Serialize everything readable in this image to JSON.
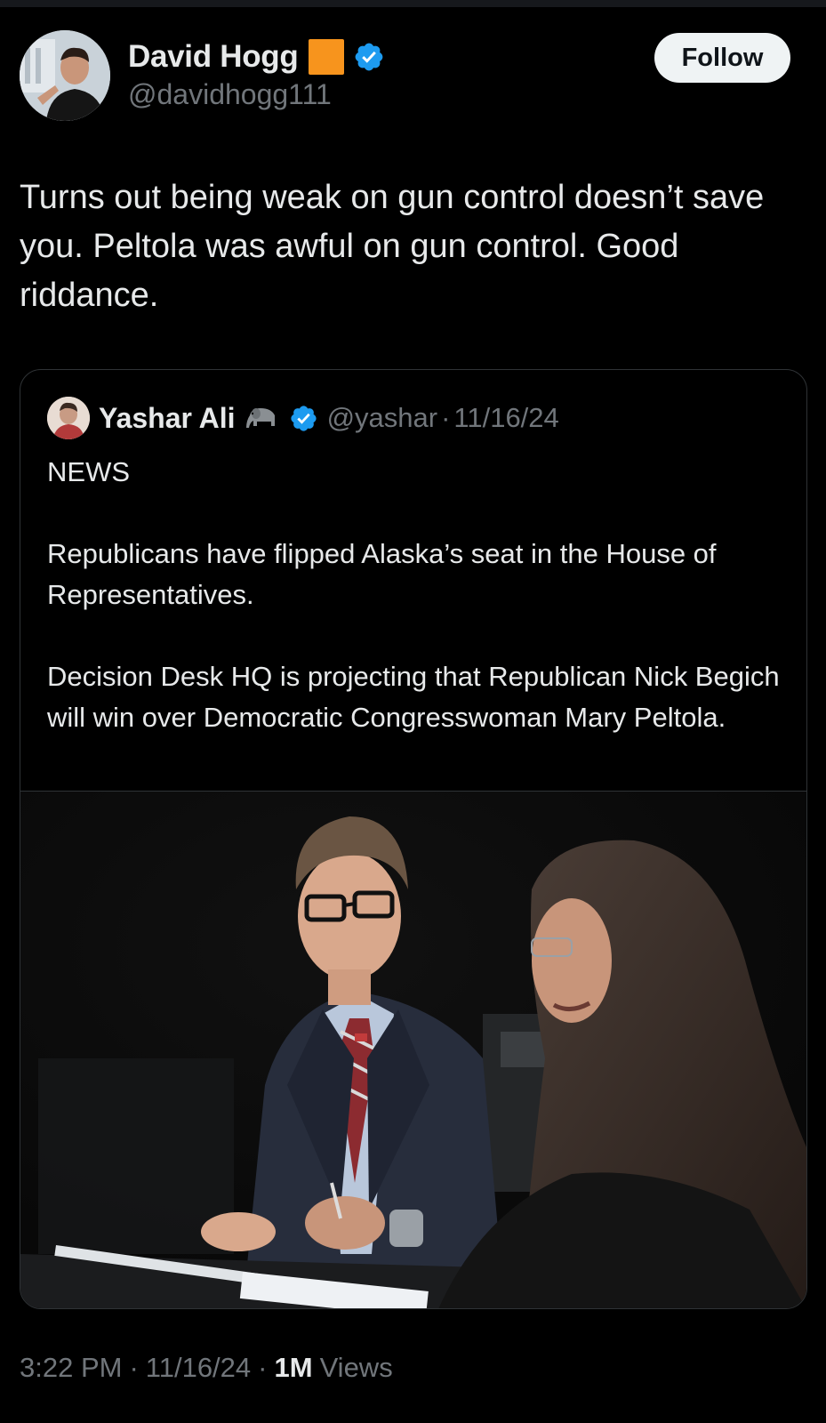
{
  "tweet": {
    "author": {
      "name": "David Hogg",
      "handle": "@davidhogg111",
      "avatar_icon": "profile-photo",
      "badge_icon": "verified-badge-icon",
      "emoji_icon": "orange-square-icon"
    },
    "follow_label": "Follow",
    "text": "Turns out being weak on gun control doesn’t save you. Peltola was awful on gun control. Good riddance.",
    "time": "3:22 PM",
    "date": "11/16/24",
    "views_count": "1M",
    "views_label": "Views",
    "separator": "·"
  },
  "quote": {
    "name": "Yashar Ali",
    "emoji_icon": "elephant-icon",
    "badge_icon": "verified-badge-icon",
    "handle": "@yashar",
    "date": "11/16/24",
    "separator": "·",
    "text": "NEWS\n\nRepublicans have flipped Alaska’s seat in the House of Representatives.\n\nDecision Desk HQ is projecting that Republican Nick Begich will win over Democratic Congresswoman Mary Peltola.",
    "photo_icon": "debate-photo"
  },
  "colors": {
    "background": "#000000",
    "text_primary": "#e7e9ea",
    "text_secondary": "#71767b",
    "verified_blue": "#1d9bf0",
    "border": "#2f3336"
  }
}
